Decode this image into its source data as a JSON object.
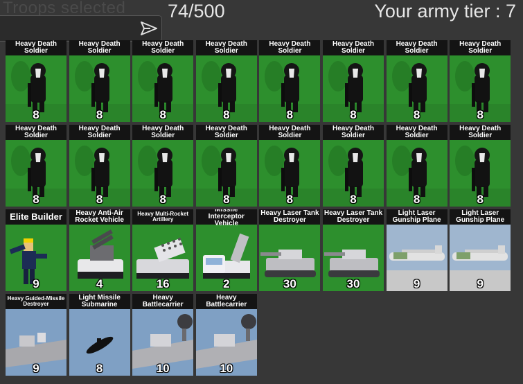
{
  "header": {
    "ghost_title": "Troops selected",
    "count": "74/500",
    "tier": "Your army tier : 7"
  },
  "chat": {
    "placeholder": "",
    "send_icon": "send-arrow-icon"
  },
  "colors": {
    "background": "#373737",
    "grass": "#2a8c2a",
    "sky": "#9fb6cf",
    "sea": "#7fa0c4"
  },
  "units": [
    {
      "name": "Heavy Death Soldier",
      "price": "8",
      "kind": "soldier"
    },
    {
      "name": "Heavy Death Soldier",
      "price": "8",
      "kind": "soldier"
    },
    {
      "name": "Heavy Death Soldier",
      "price": "8",
      "kind": "soldier"
    },
    {
      "name": "Heavy Death Soldier",
      "price": "8",
      "kind": "soldier"
    },
    {
      "name": "Heavy Death Soldier",
      "price": "8",
      "kind": "soldier"
    },
    {
      "name": "Heavy Death Soldier",
      "price": "8",
      "kind": "soldier"
    },
    {
      "name": "Heavy Death Soldier",
      "price": "8",
      "kind": "soldier"
    },
    {
      "name": "Heavy Death Soldier",
      "price": "8",
      "kind": "soldier"
    },
    {
      "name": "Heavy Death Soldier",
      "price": "8",
      "kind": "soldier"
    },
    {
      "name": "Heavy Death Soldier",
      "price": "8",
      "kind": "soldier"
    },
    {
      "name": "Heavy Death Soldier",
      "price": "8",
      "kind": "soldier"
    },
    {
      "name": "Heavy Death Soldier",
      "price": "8",
      "kind": "soldier"
    },
    {
      "name": "Heavy Death Soldier",
      "price": "8",
      "kind": "soldier"
    },
    {
      "name": "Heavy Death Soldier",
      "price": "8",
      "kind": "soldier"
    },
    {
      "name": "Heavy Death Soldier",
      "price": "8",
      "kind": "soldier"
    },
    {
      "name": "Heavy Death Soldier",
      "price": "8",
      "kind": "soldier"
    },
    {
      "name": "Elite Builder",
      "price": "9",
      "kind": "builder"
    },
    {
      "name": "Heavy Anti-Air Rocket Vehicle",
      "price": "4",
      "kind": "antiair"
    },
    {
      "name": "Heavy Multi-Rocket Artillery",
      "price": "16",
      "kind": "artillery"
    },
    {
      "name": "Missile Interceptor Vehicle",
      "price": "2",
      "kind": "interceptor"
    },
    {
      "name": "Heavy Laser Tank Destroyer",
      "price": "30",
      "kind": "tankd"
    },
    {
      "name": "Heavy Laser Tank Destroyer",
      "price": "30",
      "kind": "tankd"
    },
    {
      "name": "Light Laser Gunship Plane",
      "price": "9",
      "kind": "plane"
    },
    {
      "name": "Light Laser Gunship Plane",
      "price": "9",
      "kind": "plane"
    },
    {
      "name": "Heavy Guided-Missile Destroyer",
      "price": "9",
      "kind": "destroyer"
    },
    {
      "name": "Light Missile Submarine",
      "price": "8",
      "kind": "sub"
    },
    {
      "name": "Heavy Battlecarrier",
      "price": "10",
      "kind": "carrier"
    },
    {
      "name": "Heavy Battlecarrier",
      "price": "10",
      "kind": "carrier"
    }
  ]
}
